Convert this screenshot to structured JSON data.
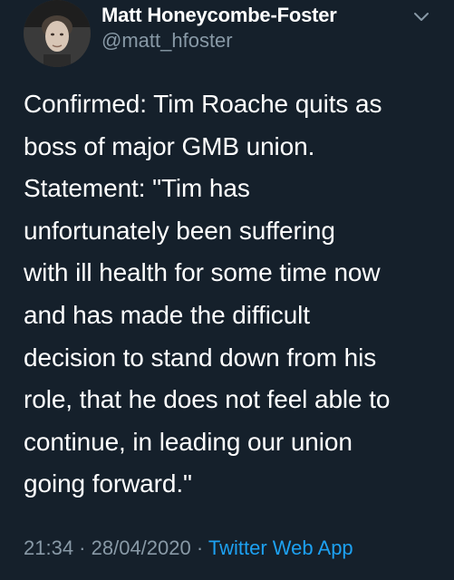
{
  "author": {
    "name": "Matt Honeycombe-Foster",
    "handle": "@matt_hfoster"
  },
  "icons": {
    "avatar": "profile-photo",
    "caret": "chevron-down-icon"
  },
  "tweet": {
    "lines": [
      "Confirmed: Tim Roache quits as",
      "boss of major GMB union.",
      "Statement: \"Tim has",
      "unfortunately been suffering",
      "with ill health for some time now",
      "and has made the difficult",
      "decision to stand down from his",
      "role, that he does not feel able to",
      "continue, in leading our union",
      "going forward.\""
    ]
  },
  "meta": {
    "time": "21:34",
    "sep1": " · ",
    "date": "28/04/2020",
    "sep2": " · ",
    "source": "Twitter Web App"
  },
  "colors": {
    "background": "#15202b",
    "primary_text": "#ffffff",
    "secondary_text": "#8899a6",
    "link": "#1da1f2"
  }
}
